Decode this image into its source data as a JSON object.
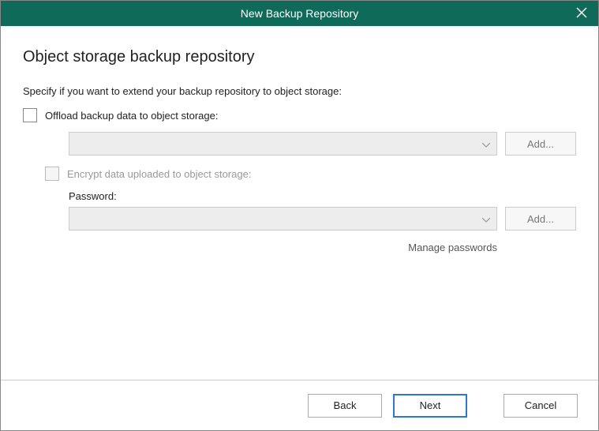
{
  "titlebar": {
    "title": "New Backup Repository"
  },
  "page": {
    "title": "Object storage backup repository",
    "subtitle": "Specify if you want to extend your backup repository to object storage:"
  },
  "offload": {
    "label": "Offload backup data to object storage:",
    "add_button": "Add..."
  },
  "encrypt": {
    "label": "Encrypt data uploaded to object storage:",
    "password_label": "Password:",
    "add_button": "Add...",
    "manage_link": "Manage passwords"
  },
  "footer": {
    "back": "Back",
    "next": "Next",
    "cancel": "Cancel"
  }
}
